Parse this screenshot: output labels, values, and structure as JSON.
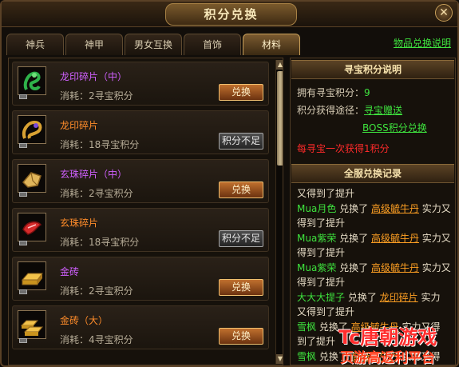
{
  "window": {
    "title": "积分兑换",
    "close_glyph": "✕"
  },
  "tabs": [
    {
      "label": "神兵",
      "active": false
    },
    {
      "label": "神甲",
      "active": false
    },
    {
      "label": "男女互换",
      "active": false
    },
    {
      "label": "首饰",
      "active": false
    },
    {
      "label": "材料",
      "active": true
    }
  ],
  "help_link": "物品兑换说明",
  "items": [
    {
      "name": "龙印碎片（中）",
      "name_color": "#d060ff",
      "cost": "消耗：2寻宝积分",
      "button": "兑换",
      "affordable": true,
      "icon": "green-dragon-icon"
    },
    {
      "name": "龙印碎片",
      "name_color": "#ff8c2a",
      "cost": "消耗：18寻宝积分",
      "button": "积分不足",
      "affordable": false,
      "icon": "gold-dragon-icon"
    },
    {
      "name": "玄珠碎片（中）",
      "name_color": "#d060ff",
      "cost": "消耗：2寻宝积分",
      "button": "兑换",
      "affordable": true,
      "icon": "gold-shard-icon"
    },
    {
      "name": "玄珠碎片",
      "name_color": "#ff8c2a",
      "cost": "消耗：18寻宝积分",
      "button": "积分不足",
      "affordable": false,
      "icon": "red-shard-icon"
    },
    {
      "name": "金砖",
      "name_color": "#d060ff",
      "cost": "消耗：2寻宝积分",
      "button": "兑换",
      "affordable": true,
      "icon": "gold-brick-icon"
    },
    {
      "name": "金砖（大）",
      "name_color": "#ff8c2a",
      "cost": "消耗：4寻宝积分",
      "button": "兑换",
      "affordable": true,
      "icon": "gold-bricks-large-icon"
    }
  ],
  "points_info": {
    "header": "寻宝积分说明",
    "owned_label": "拥有寻宝积分：",
    "owned_value": "9",
    "ways_label": "积分获得途径：",
    "way1": "寻宝赠送",
    "way2": "BOSS积分兑换",
    "note": "每寻宝一次获得1积分"
  },
  "records": {
    "header": "全服兑换记录",
    "lines": [
      [
        {
          "t": "又得到了提升",
          "c": ""
        }
      ],
      [
        {
          "t": "Mua月色",
          "c": "green"
        },
        {
          "t": " 兑换了 ",
          "c": ""
        },
        {
          "t": "高级毓牛丹",
          "c": "orange"
        },
        {
          "t": " 实力又",
          "c": ""
        }
      ],
      [
        {
          "t": "得到了提升",
          "c": ""
        }
      ],
      [
        {
          "t": "Mua紫荣",
          "c": "green"
        },
        {
          "t": " 兑换了 ",
          "c": ""
        },
        {
          "t": "高级毓牛丹",
          "c": "orange"
        },
        {
          "t": " 实力又",
          "c": ""
        }
      ],
      [
        {
          "t": "得到了提升",
          "c": ""
        }
      ],
      [
        {
          "t": "Mua紫荣",
          "c": "green"
        },
        {
          "t": " 兑换了 ",
          "c": ""
        },
        {
          "t": "高级毓牛丹",
          "c": "orange"
        },
        {
          "t": " 实力又",
          "c": ""
        }
      ],
      [
        {
          "t": "得到了提升",
          "c": ""
        }
      ],
      [
        {
          "t": "大大大提子",
          "c": "green"
        },
        {
          "t": " 兑换了 ",
          "c": ""
        },
        {
          "t": "龙印碎片",
          "c": "orange"
        },
        {
          "t": " 实力",
          "c": ""
        }
      ],
      [
        {
          "t": "又得到了提升",
          "c": ""
        }
      ],
      [
        {
          "t": "雪枫",
          "c": "green"
        },
        {
          "t": " 兑换了 ",
          "c": ""
        },
        {
          "t": "高级毓牛丹",
          "c": "orange"
        },
        {
          "t": " 实力又得",
          "c": ""
        }
      ],
      [
        {
          "t": "到了提升",
          "c": ""
        }
      ],
      [
        {
          "t": "雪枫",
          "c": "green"
        },
        {
          "t": " 兑换了 ",
          "c": ""
        },
        {
          "t": "高级毓牛丹",
          "c": "orange"
        },
        {
          "t": " 实力又得",
          "c": ""
        }
      ]
    ]
  },
  "watermark": {
    "top": "Tc唐朝游戏",
    "bottom": "页游高返利平台"
  },
  "colors": {
    "accent_gold": "#c9a05a",
    "name_purple": "#d060ff",
    "name_orange": "#ff8c2a",
    "green": "#3ee23e",
    "red": "#ff2a2a"
  }
}
